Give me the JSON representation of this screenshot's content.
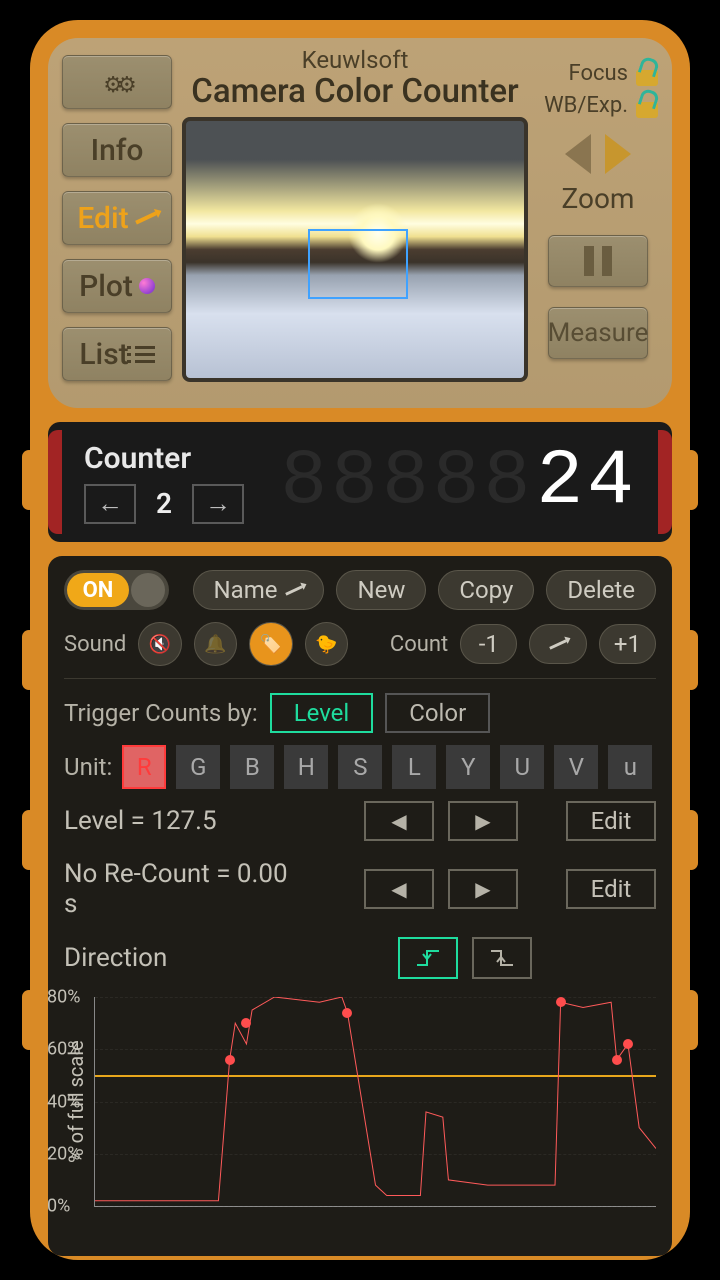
{
  "brand": "Keuwlsoft",
  "title": "Camera Color Counter",
  "nav": {
    "settings": "",
    "info": "Info",
    "edit": "Edit",
    "plot": "Plot",
    "list": "List"
  },
  "right": {
    "focus": "Focus",
    "wbexp": "WB/Exp.",
    "zoom": "Zoom",
    "measure": "Measure"
  },
  "counter": {
    "title": "Counter",
    "index": "2",
    "value": "24"
  },
  "controls": {
    "on": "ON",
    "name": "Name",
    "new": "New",
    "copy": "Copy",
    "delete": "Delete",
    "sound_label": "Sound",
    "count_label": "Count",
    "count_minus": "-1",
    "count_plus": "+1"
  },
  "trigger": {
    "label": "Trigger Counts by:",
    "level": "Level",
    "color": "Color"
  },
  "unit": {
    "label": "Unit:",
    "options": [
      "R",
      "G",
      "B",
      "H",
      "S",
      "L",
      "Y",
      "U",
      "V",
      "u"
    ],
    "selected": "R"
  },
  "level": {
    "text": "Level = 127.5",
    "edit": "Edit"
  },
  "recount": {
    "text": "No Re-Count = 0.00 s",
    "edit": "Edit"
  },
  "direction": {
    "label": "Direction"
  },
  "chart_data": {
    "type": "line",
    "ylabel": "% of full scale",
    "ylim": [
      0,
      80
    ],
    "yticks": [
      0,
      20,
      40,
      60,
      80
    ],
    "ytick_labels": [
      "0%",
      "20%",
      "40%",
      "60%",
      "80%"
    ],
    "threshold": 50,
    "x": [
      0,
      6,
      22,
      24,
      25,
      27,
      28,
      32,
      40,
      44,
      45,
      50,
      52,
      58,
      59,
      62,
      63,
      70,
      82,
      83,
      87,
      92,
      93,
      95,
      97,
      100
    ],
    "y": [
      2,
      2,
      2,
      56,
      70,
      62,
      75,
      80,
      78,
      80,
      74,
      8,
      4,
      4,
      36,
      34,
      10,
      8,
      8,
      78,
      76,
      78,
      56,
      62,
      30,
      22
    ],
    "markers_x": [
      24,
      27,
      45,
      83,
      93,
      95
    ],
    "markers_y": [
      56,
      70,
      74,
      78,
      56,
      62
    ]
  }
}
